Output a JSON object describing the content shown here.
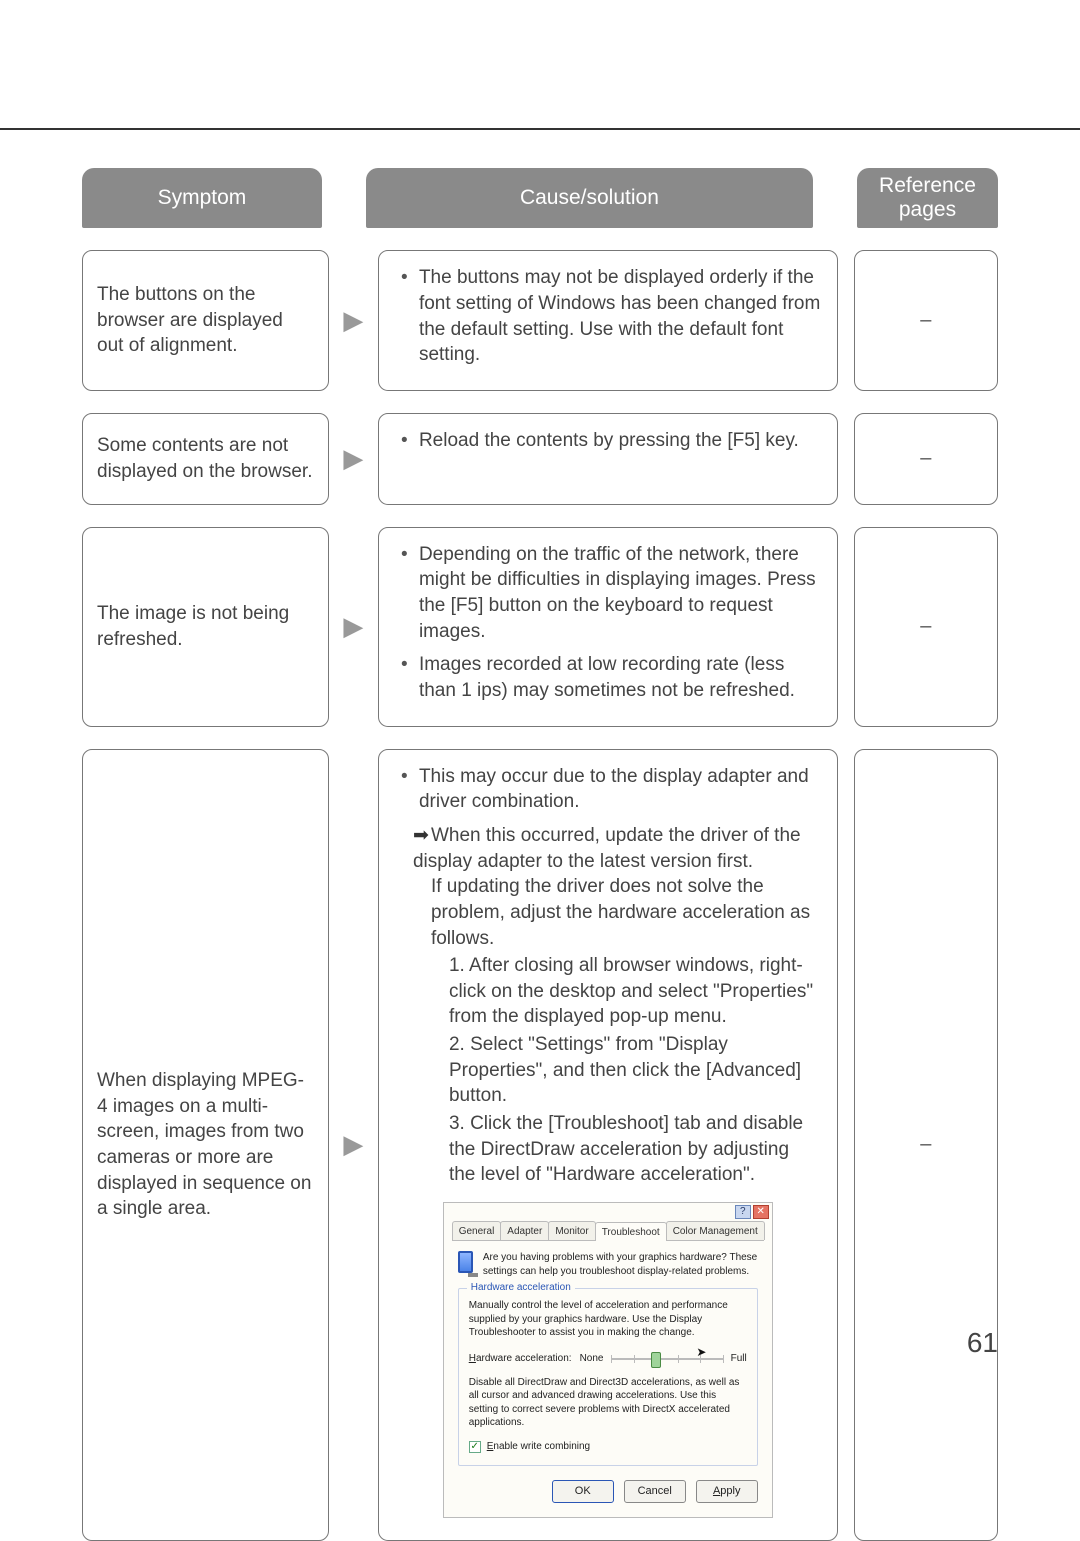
{
  "page_number": "61",
  "headers": {
    "symptom": "Symptom",
    "cause": "Cause/solution",
    "reference": "Reference pages"
  },
  "rows": [
    {
      "symptom": "The buttons on the browser are displayed out of align­ment.",
      "cause_bullets": [
        "The buttons may not be displayed orderly if the font setting of Windows has been changed from the default setting. Use with the default font setting."
      ],
      "reference": "–"
    },
    {
      "symptom": "Some contents are not dis­played on the browser.",
      "cause_bullets": [
        "Reload the contents by pressing the [F5] key."
      ],
      "reference": "–"
    },
    {
      "symptom": "The image is not being refreshed.",
      "cause_bullets": [
        "Depending on the traffic of the network, there might be difficulties in displaying images. Press the [F5] but­ton on the keyboard to request images.",
        "Images recorded at low recording rate (less than 1 ips) may sometimes not be refreshed."
      ],
      "reference": "–"
    },
    {
      "symptom": "When displaying MPEG-4 images on a multi-screen, images from two cameras or more are displayed in sequence on a single area.",
      "cause_intro_bullet": "This may occur due to the display adapter and driver combination.",
      "arrow_line1": "When this occurred, update the driver of the display adapter to the latest version first.",
      "arrow_line2": "If updating the driver does not solve the problem, adjust the hardware acceleration as follows.",
      "steps": [
        "1. After closing all browser windows, right-click on the desktop and select \"Properties\" from the displayed pop-up menu.",
        "2. Select \"Settings\" from \"Display Properties\", and then click the [Advanced] button.",
        "3. Click the [Troubleshoot] tab and disable the DirectDraw acceleration by adjusting the level of \"Hardware acceleration\"."
      ],
      "reference": "–",
      "dialog": {
        "tabs": [
          "General",
          "Adapter",
          "Monitor",
          "Troubleshoot",
          "Color Management"
        ],
        "active_tab_index": 3,
        "intro": "Are you having problems with your graphics hardware? These settings can help you troubleshoot display-related problems.",
        "fieldset_legend": "Hardware acceleration",
        "fieldset_text": "Manually control the level of acceleration and performance supplied by your graphics hardware. Use the Display Troubleshooter to assist you in making the change.",
        "slider_label": "Hardware acceleration:",
        "slider_min": "None",
        "slider_max": "Full",
        "slider_desc": "Disable all DirectDraw and Direct3D accelerations, as well as all cursor and advanced drawing accelerations. Use this setting to correct severe problems with DirectX accelerated applications.",
        "checkbox_label": "Enable write combining",
        "buttons": {
          "ok": "OK",
          "cancel": "Cancel",
          "apply": "Apply"
        }
      }
    }
  ]
}
